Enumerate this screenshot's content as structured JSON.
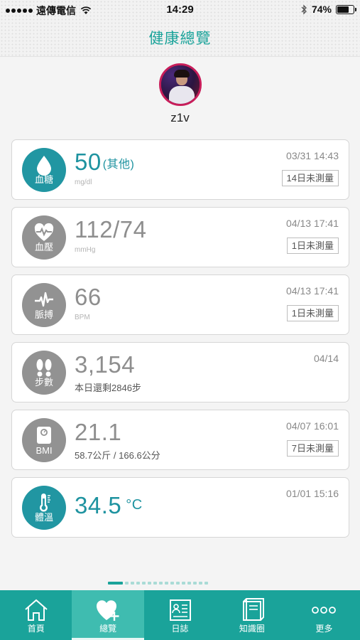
{
  "status_bar": {
    "carrier": "遠傳電信",
    "time": "14:29",
    "battery": "74%",
    "battery_level": 0.74
  },
  "header": {
    "title": "健康總覽"
  },
  "profile": {
    "username": "z1v"
  },
  "cards": [
    {
      "name": "blood-sugar",
      "icon": "blood-drop-icon",
      "label": "血糖",
      "value": "50",
      "suffix": "(其他)",
      "unit": "mg/dl",
      "timestamp": "03/31 14:43",
      "badge": "14日未測量"
    },
    {
      "name": "blood-pressure",
      "icon": "heart-pulse-icon",
      "label": "血壓",
      "value": "112/74",
      "unit": "mmHg",
      "timestamp": "04/13 17:41",
      "badge": "1日未測量"
    },
    {
      "name": "pulse",
      "icon": "heartbeat-wave-icon",
      "label": "脈搏",
      "value": "66",
      "unit": "BPM",
      "timestamp": "04/13 17:41",
      "badge": "1日未測量"
    },
    {
      "name": "steps",
      "icon": "footprints-icon",
      "label": "步數",
      "value": "3,154",
      "unit": "本日還剩2846步",
      "timestamp": "04/14"
    },
    {
      "name": "bmi",
      "icon": "scale-icon",
      "label": "BMI",
      "value": "21.1",
      "unit": "58.7公斤 / 166.6公分",
      "timestamp": "04/07 16:01",
      "badge": "7日未測量"
    },
    {
      "name": "temperature",
      "icon": "thermometer-icon",
      "label": "體溫",
      "value": "34.5",
      "suffix": "°C",
      "timestamp": "01/01 15:16"
    }
  ],
  "pager": {
    "count": 16,
    "active_index": 0
  },
  "tab_bar": {
    "tabs": [
      {
        "label": "首頁",
        "icon": "home-icon"
      },
      {
        "label": "總覽",
        "icon": "heart-plus-icon",
        "active": true
      },
      {
        "label": "日誌",
        "icon": "journal-icon"
      },
      {
        "label": "知識圈",
        "icon": "book-icon"
      },
      {
        "label": "更多",
        "icon": "more-dots-icon"
      }
    ]
  },
  "colors": {
    "accent": "#1aa39a",
    "teal_icon": "#2196a2",
    "inactive_icon": "#929292",
    "avatar_ring": "#c81d5a"
  }
}
